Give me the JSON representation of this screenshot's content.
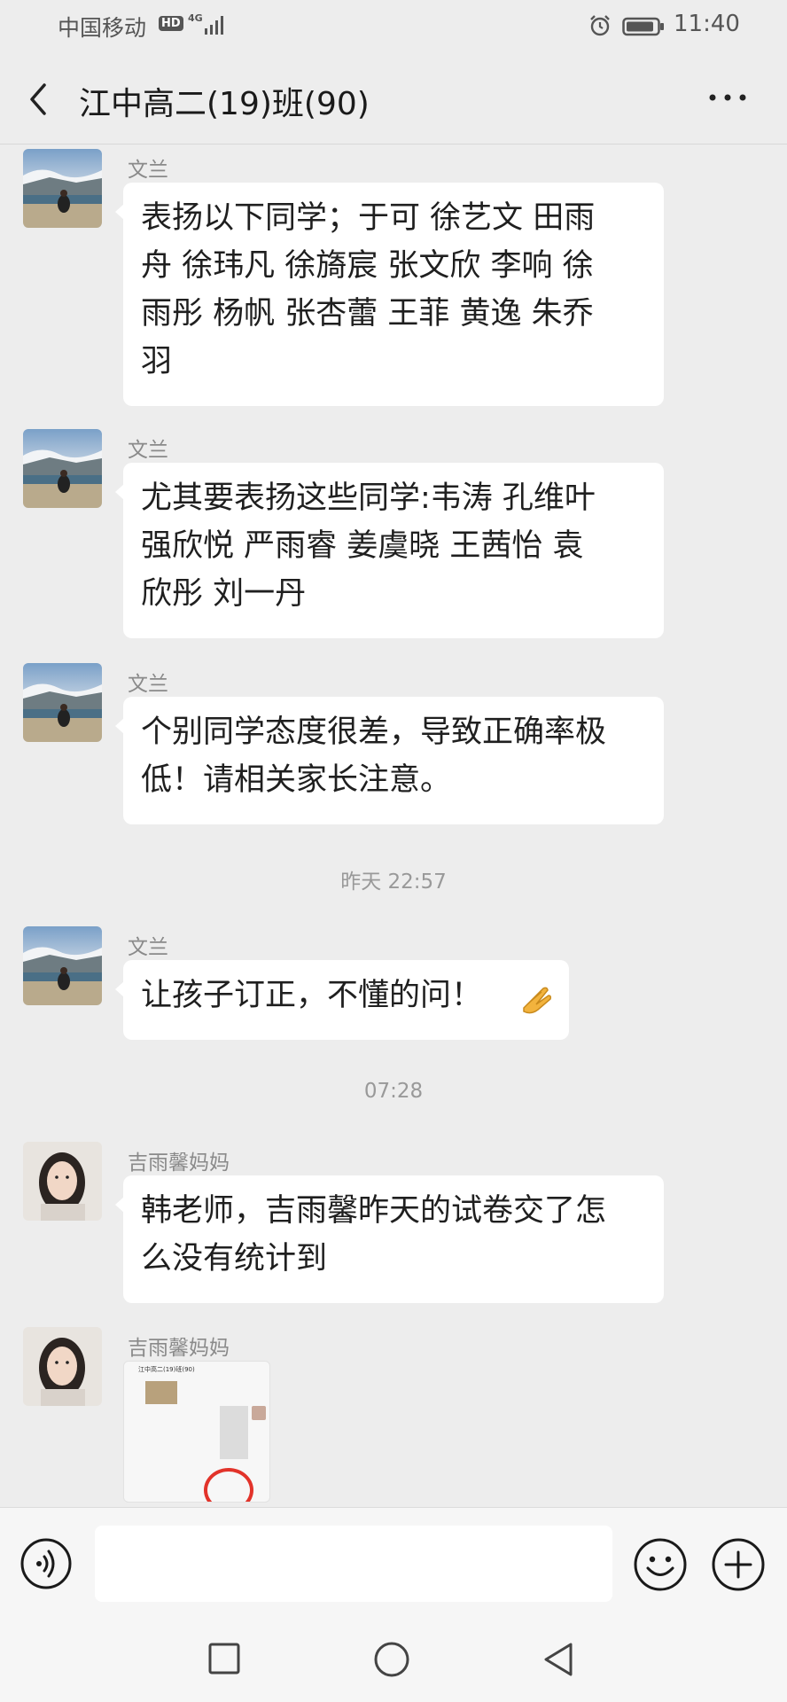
{
  "status_bar": {
    "carrier": "中国移动",
    "hd": "HD",
    "network": "4G",
    "time": "11:40"
  },
  "header": {
    "title": "江中高二(19)班(90)"
  },
  "messages": [
    {
      "sender": "文兰",
      "lines": [
        "表扬以下同学；于可 徐艺文  田雨",
        "舟 徐玮凡 徐旖宸 张文欣  李响  徐",
        "雨彤  杨帆  张杏蕾 王菲  黄逸  朱乔",
        "羽"
      ]
    },
    {
      "sender": "文兰",
      "lines": [
        "尤其要表扬这些同学:韦涛  孔维叶",
        "强欣悦 严雨睿   姜虞晓   王茜怡  袁",
        "欣彤  刘一丹"
      ]
    },
    {
      "sender": "文兰",
      "lines": [
        "个别同学态度很差，导致正确率极",
        "低！请相关家长注意。"
      ]
    },
    {
      "sender": "文兰",
      "lines": [
        "让孩子订正，不懂的问！"
      ]
    },
    {
      "sender": "吉雨馨妈妈",
      "lines": [
        "韩老师，吉雨馨昨天的试卷交了怎",
        "么没有统计到"
      ]
    },
    {
      "sender": "吉雨馨妈妈",
      "image_caption": "江中高二(19)班(90)"
    }
  ],
  "timestamps": [
    "昨天 22:57",
    "07:28"
  ],
  "input_bar": {
    "placeholder": "",
    "value": ""
  },
  "colors": {
    "background": "#ededed",
    "bubble": "#ffffff",
    "name_text": "#8a8a8a",
    "timestamp_text": "#999999"
  },
  "icons": [
    "back-icon",
    "more-icon",
    "voice-icon",
    "emoji-icon",
    "plus-icon",
    "nav-recent-icon",
    "nav-home-icon",
    "nav-back-icon",
    "alarm-icon",
    "battery-icon",
    "signal-icon"
  ]
}
